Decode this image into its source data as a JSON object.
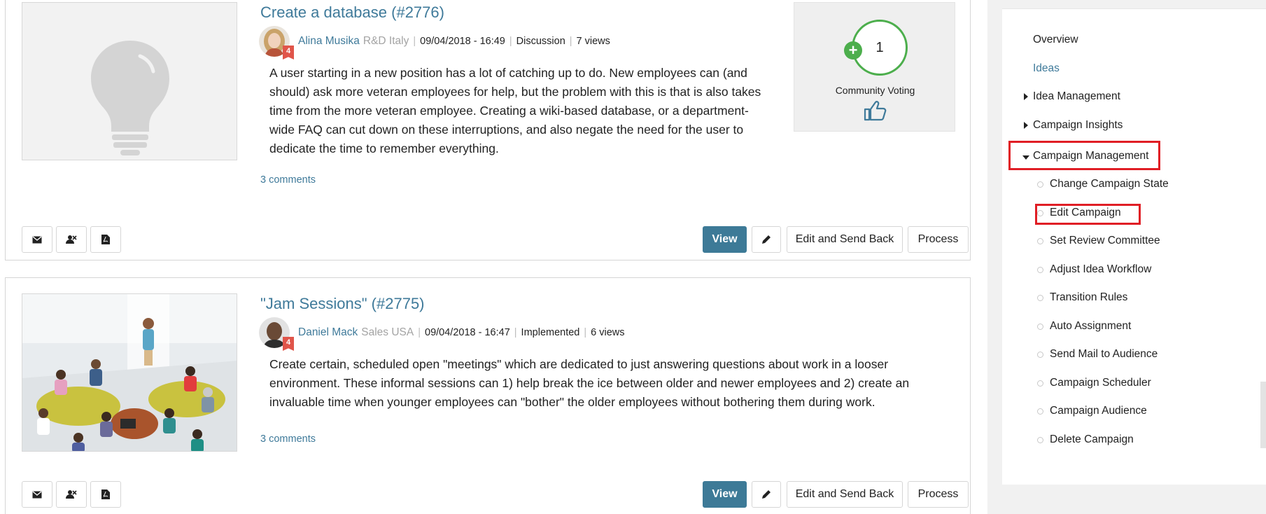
{
  "ideas": [
    {
      "title": "Create a database (#2776)",
      "author": "Alina Musika",
      "department": "R&D Italy",
      "date": "09/04/2018 - 16:49",
      "status": "Discussion",
      "views": "7 views",
      "badge": "4",
      "description": "A user starting in a new position has a lot of catching up to do. New employees can (and should) ask more veteran employees for help, but the problem with this is that is also takes time from the more veteran employee. Creating a wiki-based database, or a department-wide FAQ can cut down on these interruptions, and also negate the need for the user to dedicate the time to remember everything.",
      "comments": "3 comments",
      "vote_count": "1",
      "vote_label": "Community Voting",
      "thumbnail_icon": "lightbulb-icon"
    },
    {
      "title": "\"Jam Sessions\" (#2775)",
      "author": "Daniel Mack",
      "department": "Sales USA",
      "date": "09/04/2018 - 16:47",
      "status": "Implemented",
      "views": "6 views",
      "badge": "4",
      "description": "Create certain, scheduled open \"meetings\" which are dedicated to just answering questions about work in a looser environment. These informal sessions can 1) help break the ice between older and newer employees and 2) create an invaluable time when younger employees can \"bother\" the older employees without bothering them during work.",
      "comments": "3 comments"
    }
  ],
  "actions": {
    "view": "View",
    "edit_send_back": "Edit and Send Back",
    "process": "Process",
    "icons": [
      "mail-icon",
      "user-remove-icon",
      "pdf-icon",
      "pencil-icon"
    ]
  },
  "sidebar": {
    "overview": "Overview",
    "ideas": "Ideas",
    "idea_management": "Idea Management",
    "campaign_insights": "Campaign Insights",
    "campaign_management": "Campaign Management",
    "sub_items": [
      "Change Campaign State",
      "Edit Campaign",
      "Set Review Committee",
      "Adjust Idea Workflow",
      "Transition Rules",
      "Auto Assignment",
      "Send Mail to Audience",
      "Campaign Scheduler",
      "Campaign Audience",
      "Delete Campaign"
    ]
  },
  "colors": {
    "link": "#3f7a9a",
    "primary_button": "#3d7a97",
    "vote_green": "#4cae4c",
    "highlight_red": "#e01e25",
    "badge_red": "#e0554a"
  }
}
